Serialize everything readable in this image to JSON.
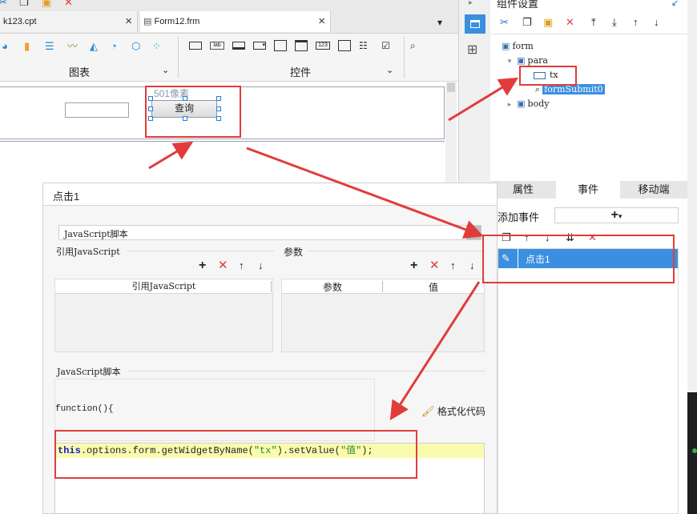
{
  "tabs": {
    "file1": "k123.cpt",
    "file2": "Form12.frm",
    "close": "×"
  },
  "ribbon": {
    "group_chart": "图表",
    "group_widgets": "控件"
  },
  "canvas": {
    "size_hint": "501像素",
    "query_button": "查询"
  },
  "dialog": {
    "title": "点击1",
    "script_type": "JavaScript脚本",
    "ref_js_label": "引用JavaScript",
    "params_label": "参数",
    "ref_js_col": "引用JavaScript",
    "param_col": "参数",
    "value_col": "值",
    "script_section": "JavaScript脚本",
    "function_text": "function(){",
    "format_code": "格式化代码",
    "code_keyword": "this",
    "code_rest": ".options.form.getWidgetByName(",
    "code_arg1": "\"tx\"",
    "code_mid": ").setValue(",
    "code_arg2": "\"值\"",
    "code_end": ");"
  },
  "component_panel": {
    "title": "组件设置",
    "tree": {
      "form": "form",
      "para": "para",
      "tx": "tx",
      "submit": "formSubmit0",
      "body": "body"
    }
  },
  "event_panel": {
    "tab_props": "属性",
    "tab_events": "事件",
    "tab_mobile": "移动端",
    "add_event": "添加事件",
    "event_item": "点击1"
  },
  "colors": {
    "accent": "#3b8fe0",
    "annotation": "#e23b3b",
    "highlight": "#fbfbb0"
  }
}
